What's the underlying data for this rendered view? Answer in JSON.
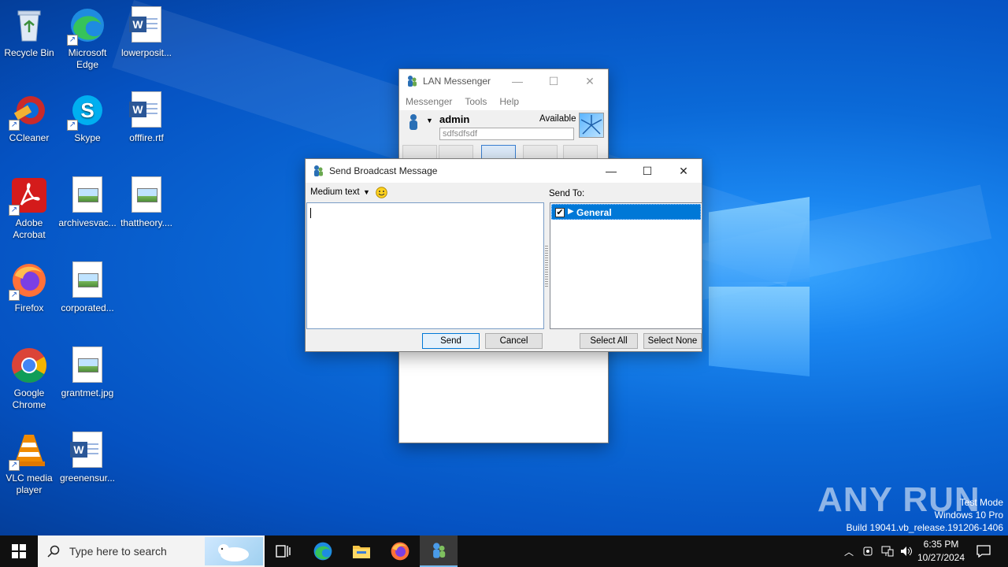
{
  "desktop": {
    "icons": [
      {
        "label": "Recycle Bin",
        "icon": "recycle-bin-icon"
      },
      {
        "label": "Microsoft Edge",
        "icon": "edge-icon"
      },
      {
        "label": "lowerposit...",
        "icon": "word-doc-icon"
      },
      {
        "label": "CCleaner",
        "icon": "ccleaner-icon"
      },
      {
        "label": "Skype",
        "icon": "skype-icon"
      },
      {
        "label": "offfire.rtf",
        "icon": "word-doc-icon"
      },
      {
        "label": "Adobe Acrobat",
        "icon": "acrobat-icon"
      },
      {
        "label": "archivesvac...",
        "icon": "image-file-icon"
      },
      {
        "label": "thattheory....",
        "icon": "image-file-icon"
      },
      {
        "label": "Firefox",
        "icon": "firefox-icon"
      },
      {
        "label": "corporated...",
        "icon": "image-file-icon"
      },
      {
        "label": "Google Chrome",
        "icon": "chrome-icon"
      },
      {
        "label": "grantmet.jpg",
        "icon": "image-file-icon"
      },
      {
        "label": "VLC media player",
        "icon": "vlc-icon"
      },
      {
        "label": "greenensur...",
        "icon": "word-doc-icon"
      }
    ]
  },
  "lan_messenger": {
    "title": "LAN Messenger",
    "menu": [
      "Messenger",
      "Tools",
      "Help"
    ],
    "username": "admin",
    "status": "Available",
    "note": "sdfsdfsdf"
  },
  "broadcast": {
    "title": "Send Broadcast Message",
    "font_size": "Medium text",
    "send_to_label": "Send To:",
    "group": "General",
    "group_checked": true,
    "send": "Send",
    "cancel": "Cancel",
    "select_all": "Select All",
    "select_none": "Select None"
  },
  "watermark": {
    "brand": "ANY RUN",
    "line1": "Test Mode",
    "line2": "Windows 10 Pro",
    "line3": "Build 19041.vb_release.191206-1406"
  },
  "taskbar": {
    "search_placeholder": "Type here to search",
    "time": "6:35 PM",
    "date": "10/27/2024"
  },
  "colors": {
    "accent": "#0078d7",
    "selection": "#0078d7",
    "taskbar": "#101010"
  }
}
